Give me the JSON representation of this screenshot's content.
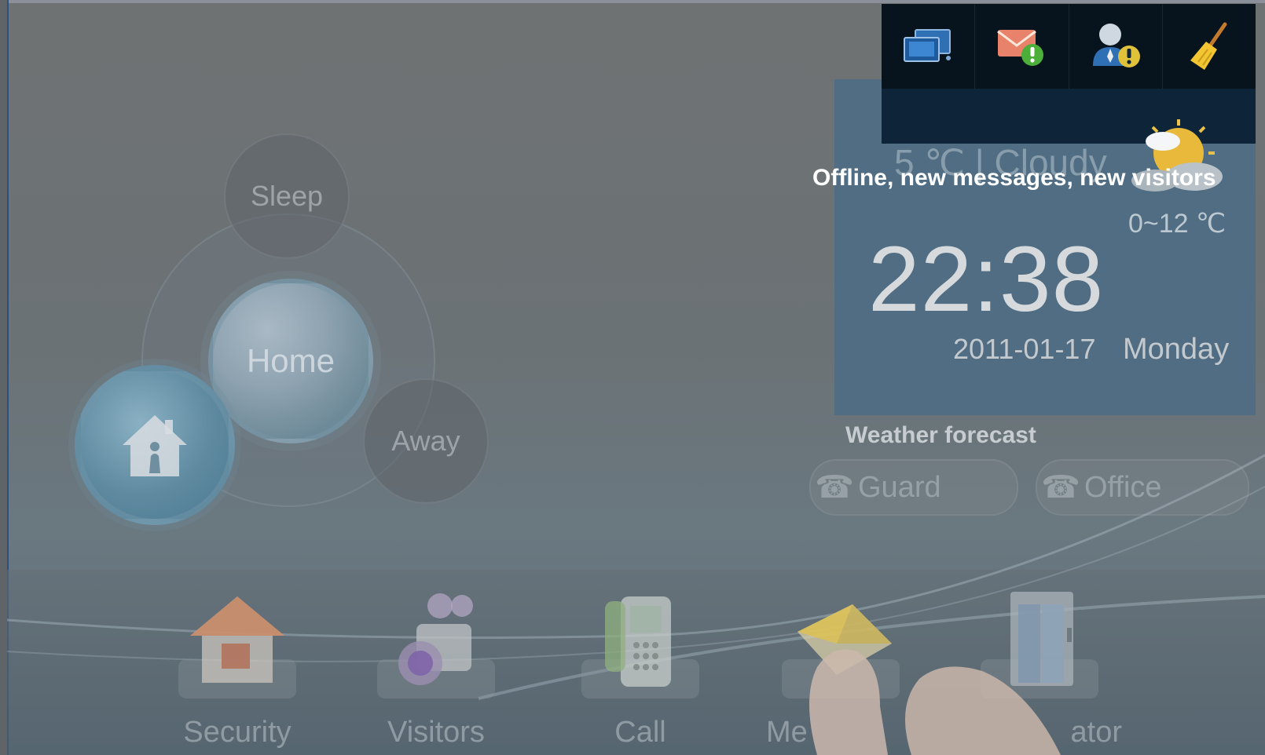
{
  "modes": {
    "sleep_label": "Sleep",
    "home_label": "Home",
    "away_label": "Away"
  },
  "status_icons": [
    {
      "name": "network-offline-icon"
    },
    {
      "name": "new-message-icon"
    },
    {
      "name": "new-visitor-icon"
    },
    {
      "name": "clean-screen-icon"
    }
  ],
  "tooltip": "Offline, new messages, new visitors",
  "weather": {
    "current_temp": "5 ℃  |  Cloudy",
    "range": "0~12 ℃",
    "forecast_label": "Weather forecast"
  },
  "clock": {
    "time": "22:38",
    "date": "2011-01-17",
    "day": "Monday"
  },
  "call_buttons": {
    "guard_label": "Guard",
    "office_label": "Office"
  },
  "dock": {
    "security_label": "Security",
    "visitors_label": "Visitors",
    "call_label": "Call",
    "messages_label": "Me",
    "elevator_label": "ator"
  },
  "colors": {
    "icon_bar": "#07131d",
    "clock_panel": "#4f6d84",
    "alert_green": "#4caf3a",
    "alert_yellow": "#e0c23a"
  }
}
